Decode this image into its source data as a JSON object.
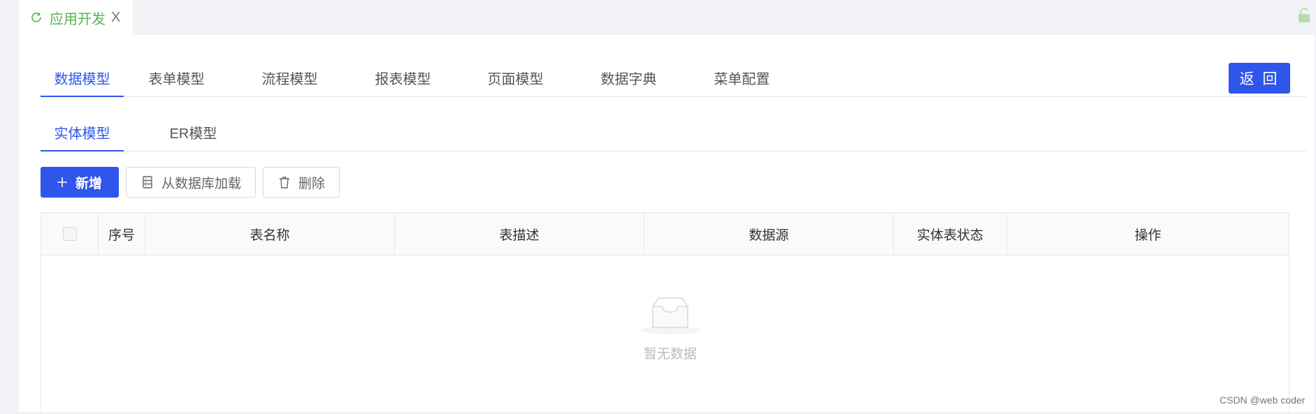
{
  "page_tab": {
    "label": "应用开发",
    "close": "X"
  },
  "main_tabs": [
    "数据模型",
    "表单模型",
    "流程模型",
    "报表模型",
    "页面模型",
    "数据字典",
    "菜单配置"
  ],
  "back_button": "返 回",
  "sub_tabs": [
    "实体模型",
    "ER模型"
  ],
  "toolbar": {
    "add": "新增",
    "load_from_db": "从数据库加载",
    "delete": "删除"
  },
  "table": {
    "columns": [
      "序号",
      "表名称",
      "表描述",
      "数据源",
      "实体表状态",
      "操作"
    ],
    "rows": []
  },
  "empty_text": "暂无数据",
  "watermark": "CSDN @web coder",
  "colors": {
    "accent": "#2f55eb",
    "tab_green": "#52b453"
  }
}
